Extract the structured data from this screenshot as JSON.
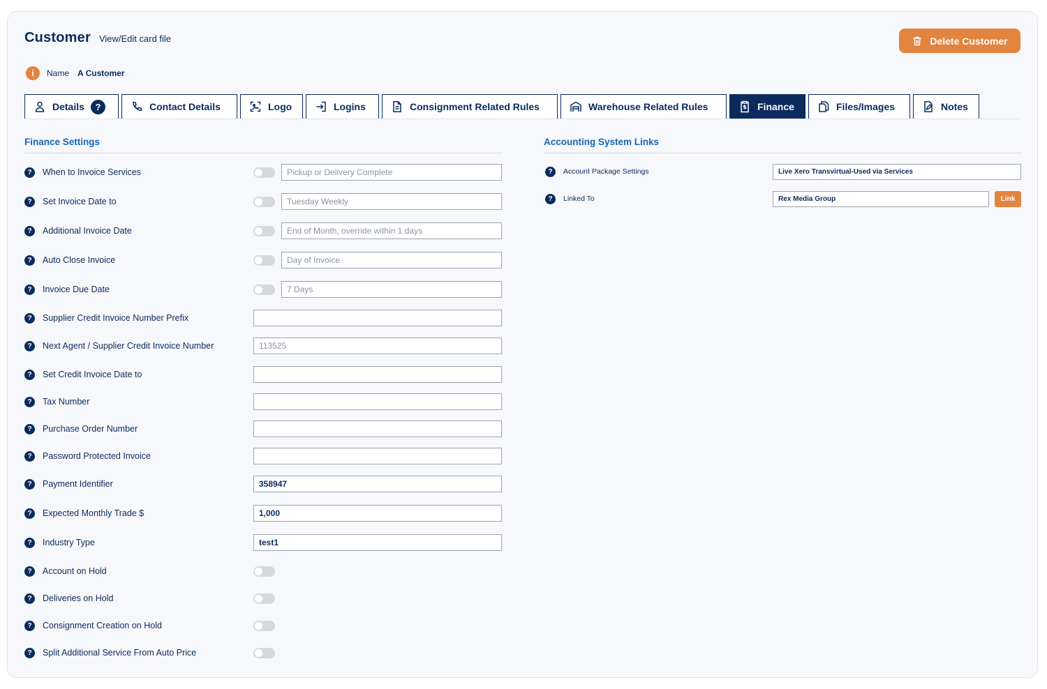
{
  "header": {
    "title": "Customer",
    "subtitle": "View/Edit card file",
    "delete_label": "Delete Customer"
  },
  "customer": {
    "info_glyph": "i",
    "name_label": "Name",
    "name_value": "A Customer"
  },
  "tabs": [
    {
      "label": "Details",
      "icon": "user-icon",
      "badge": "?"
    },
    {
      "label": "Contact Details",
      "icon": "phone-icon"
    },
    {
      "label": "Logo",
      "icon": "image-icon"
    },
    {
      "label": "Logins",
      "icon": "login-icon"
    },
    {
      "label": "Consignment Related Rules",
      "icon": "document-icon"
    },
    {
      "label": "Warehouse Related Rules",
      "icon": "warehouse-icon"
    },
    {
      "label": "Finance",
      "icon": "finance-clipboard-icon",
      "active": true
    },
    {
      "label": "Files/Images",
      "icon": "files-icon"
    },
    {
      "label": "Notes",
      "icon": "notes-icon"
    }
  ],
  "finance": {
    "title": "Finance Settings",
    "help_glyph": "?",
    "rows": [
      {
        "label": "When to Invoice Services",
        "toggle": false,
        "value": "Pickup or Delivery Complete"
      },
      {
        "label": "Set Invoice Date to",
        "toggle": false,
        "value": "Tuesday Weekly"
      },
      {
        "label": "Additional Invoice Date",
        "toggle": false,
        "value": "End of Month, override within 1 days"
      },
      {
        "label": "Auto Close Invoice",
        "toggle": false,
        "value": "Day of Invoice"
      },
      {
        "label": "Invoice Due Date",
        "toggle": false,
        "value": "7 Days"
      },
      {
        "label": "Supplier Credit Invoice Number Prefix",
        "value": ""
      },
      {
        "label": "Next Agent / Supplier Credit Invoice Number",
        "value": "113525"
      },
      {
        "label": "Set Credit Invoice Date to",
        "value": ""
      },
      {
        "label": "Tax Number",
        "value": ""
      },
      {
        "label": "Purchase Order Number",
        "value": ""
      },
      {
        "label": "Password Protected Invoice",
        "value": ""
      },
      {
        "label": "Payment Identifier",
        "value": "358947"
      },
      {
        "label": "Expected Monthly Trade $",
        "value": "1,000"
      },
      {
        "label": "Industry Type",
        "value": "test1"
      },
      {
        "label": "Account on Hold",
        "toggle": false
      },
      {
        "label": "Deliveries on Hold",
        "toggle": false
      },
      {
        "label": "Consignment Creation on Hold",
        "toggle": false
      },
      {
        "label": "Split Additional Service From Auto Price",
        "toggle": false
      }
    ]
  },
  "accounting": {
    "title": "Accounting System Links",
    "account_package_label": "Account Package Settings",
    "account_package_value": "Live Xero Transvirtual-Used via Services",
    "linked_to_label": "Linked To",
    "linked_to_value": "Rex Media Group",
    "link_button": "Link"
  },
  "colors": {
    "primary": "#0a2b5c",
    "accent": "#e2843e",
    "section_title": "#1766b5"
  }
}
